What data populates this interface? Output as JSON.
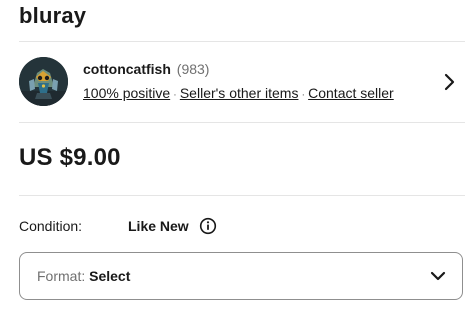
{
  "listing": {
    "title": "bluray",
    "price": "US $9.00"
  },
  "seller": {
    "name": "cottoncatfish",
    "feedback_count": "(983)",
    "positive_link": "100% positive",
    "separator": "·",
    "other_items_link": "Seller's other items",
    "contact_link": "Contact seller"
  },
  "condition": {
    "label": "Condition:",
    "value": "Like New"
  },
  "format_select": {
    "label": "Format:",
    "selected": "Select"
  },
  "icons": {
    "avatar": "seller-avatar",
    "seller_chevron": "chevron-right-icon",
    "info": "info-icon",
    "select_chevron": "chevron-down-icon"
  }
}
